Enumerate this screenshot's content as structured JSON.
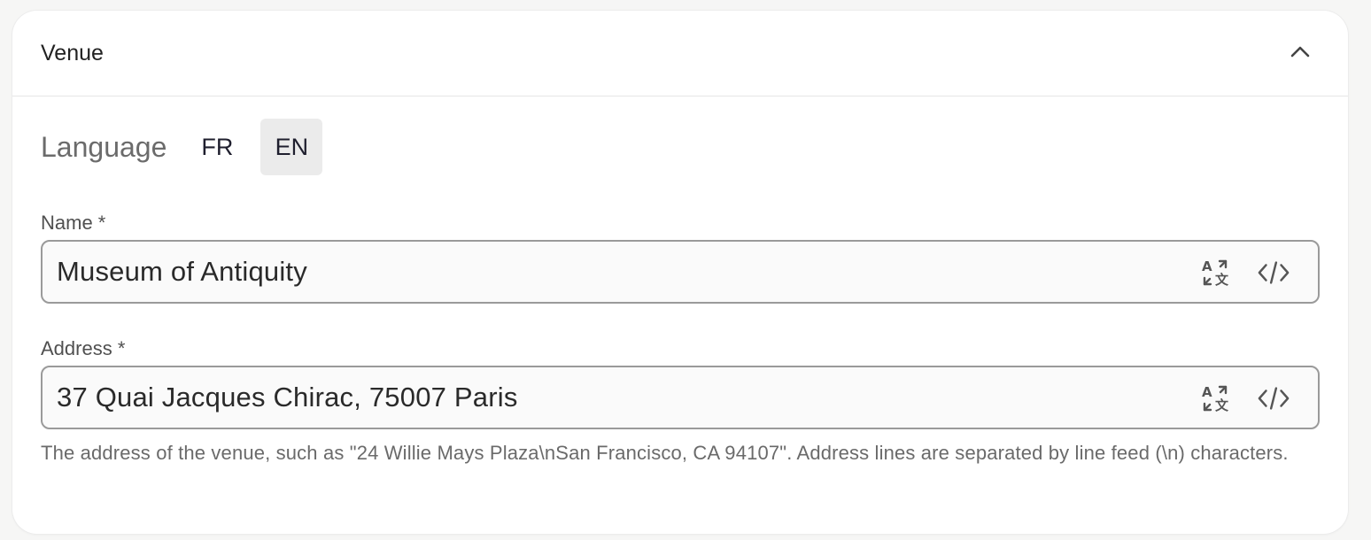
{
  "section": {
    "title": "Venue",
    "collapse_icon": "chevron-up-icon"
  },
  "language": {
    "label": "Language",
    "options": [
      "FR",
      "EN"
    ],
    "selected": "EN"
  },
  "fields": {
    "name": {
      "label": "Name *",
      "value": "Museum of Antiquity"
    },
    "address": {
      "label": "Address *",
      "value": "37 Quai Jacques Chirac, 75007 Paris",
      "help": "The address of the venue, such as \"24 Willie Mays Plaza\\nSan Francisco, CA 94107\". Address lines are separated by line feed (\\n) characters."
    }
  },
  "icons": {
    "translate": "translate-icon",
    "code": "code-icon"
  },
  "colors": {
    "active_language_bg": "#ebebeb",
    "field_border": "#9a9a9a"
  }
}
